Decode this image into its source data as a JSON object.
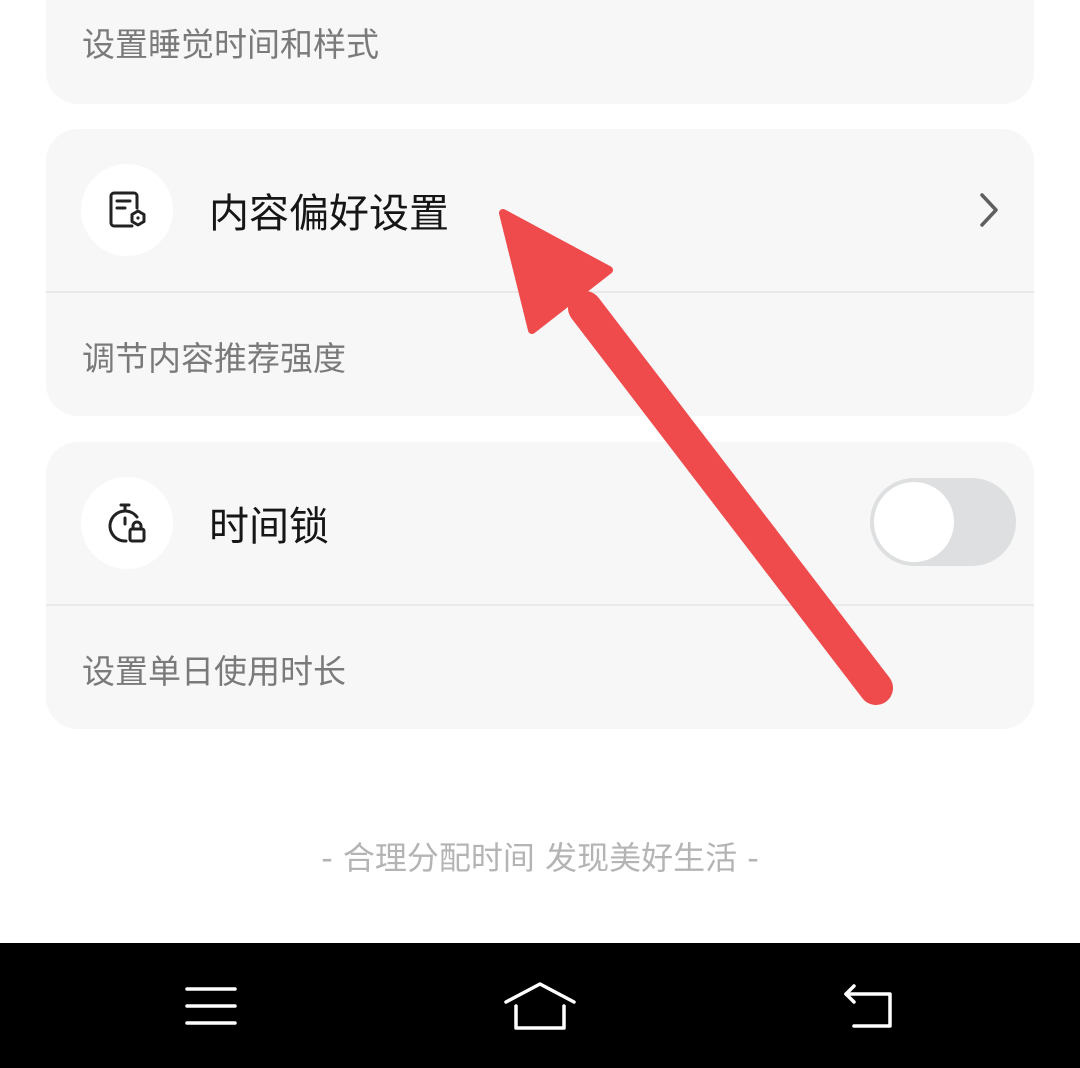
{
  "sleep_card": {
    "subtitle": "设置睡觉时间和样式"
  },
  "content_pref": {
    "title": "内容偏好设置",
    "subtitle": "调节内容推荐强度",
    "icon": "document-settings-icon"
  },
  "time_lock": {
    "title": "时间锁",
    "subtitle": "设置单日使用时长",
    "icon": "stopwatch-lock-icon",
    "enabled": false
  },
  "footer": {
    "slogan": "- 合理分配时间 发现美好生活 -"
  },
  "annotation": {
    "arrow_color": "#f04b4c"
  },
  "navbar": {
    "buttons": [
      "menu-icon",
      "home-icon",
      "back-icon"
    ]
  },
  "colors": {
    "card_bg": "#f7f7f7",
    "toggle_off": "#dedfe0",
    "navbar_bg": "#000000"
  }
}
